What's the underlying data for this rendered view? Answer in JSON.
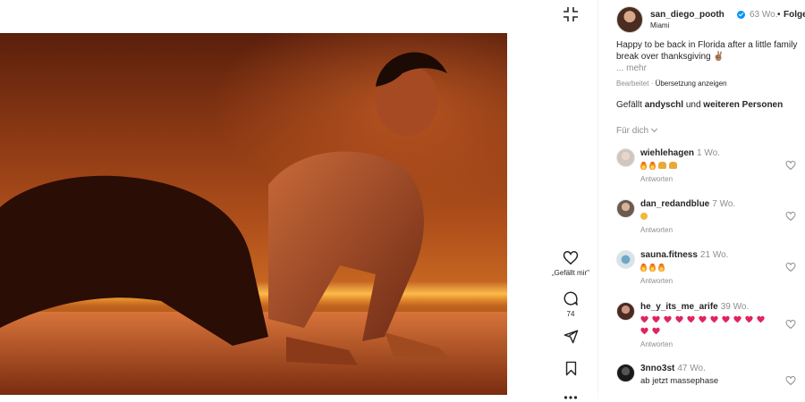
{
  "post": {
    "username": "san_diego_pooth",
    "age": "63 Wo.",
    "separator": "•",
    "follow_label": "Folgen",
    "location": "Miami",
    "caption": "Happy to be back in Florida after a little family break over thanksgiving ✌🏽",
    "caption_more": "... mehr",
    "edited_label": "Bearbeitet",
    "meta_separator": " · ",
    "translate_label": "Übersetzung anzeigen",
    "likes_prefix": "Gefällt ",
    "likes_user": "andyschl",
    "likes_mid": " und ",
    "likes_others": "weiteren Personen",
    "for_you_label": "Für dich"
  },
  "actions": {
    "like_label": "„Gefällt mir\"",
    "comment_count": "74"
  },
  "comments": [
    {
      "user": "wiehlehagen",
      "age": "1 Wo.",
      "text": "",
      "reply_label": "Antworten"
    },
    {
      "user": "dan_redandblue",
      "age": "7 Wo.",
      "text": "",
      "reply_label": "Antworten"
    },
    {
      "user": "sauna.fitness",
      "age": "21 Wo.",
      "text": "",
      "reply_label": "Antworten"
    },
    {
      "user": "he_y_its_me_arife",
      "age": "39 Wo.",
      "text": "",
      "reply_label": "Antworten"
    },
    {
      "user": "3nno3st",
      "age": "47 Wo.",
      "text": "ab jetzt massephase",
      "reply_label": ""
    }
  ],
  "colors": {
    "verified_blue": "#0095f6",
    "text_primary": "#262626",
    "text_secondary": "#8e8e8e",
    "heart_red": "#e0245e"
  },
  "icons": [
    "collapse-icon",
    "heart-icon",
    "comment-icon",
    "share-icon",
    "bookmark-icon",
    "more-icon",
    "verified-icon",
    "chevron-down-icon"
  ]
}
